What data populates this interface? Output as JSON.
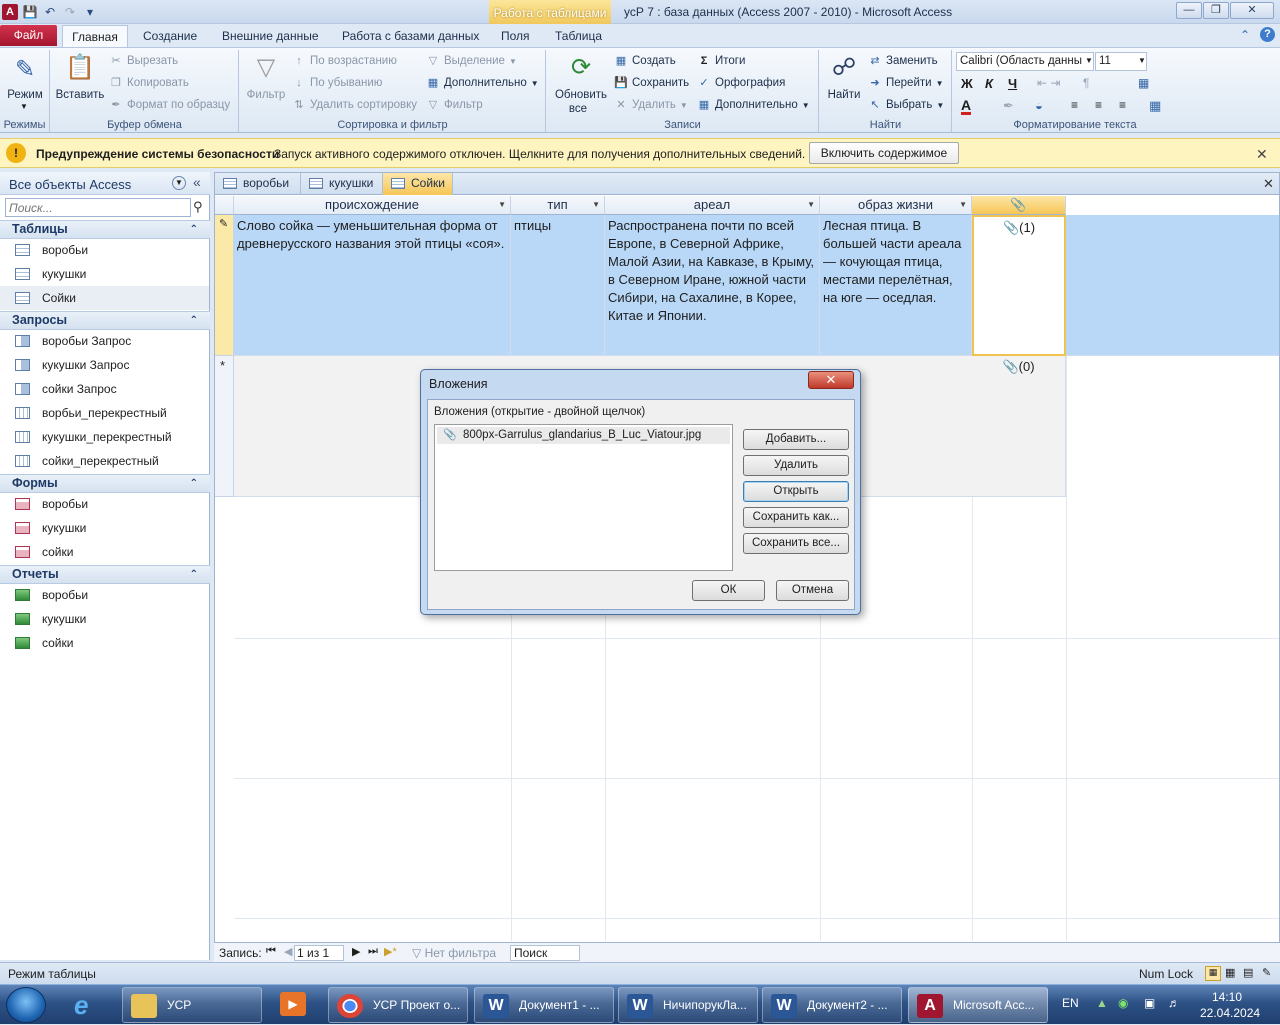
{
  "window": {
    "title": "усР 7 : база данных (Access 2007 - 2010)  -  Microsoft Access",
    "context_tab_group": "Работа с таблицами"
  },
  "ribbon_tabs": [
    "Файл",
    "Главная",
    "Создание",
    "Внешние данные",
    "Работа с базами данных",
    "Поля",
    "Таблица"
  ],
  "ribbon": {
    "modes": {
      "view_label": "Режим",
      "group": "Режимы"
    },
    "clipboard": {
      "paste": "Вставить",
      "cut": "Вырезать",
      "copy": "Копировать",
      "format_painter": "Формат по образцу",
      "group": "Буфер обмена"
    },
    "sort": {
      "filter": "Фильтр",
      "asc": "По возрастанию",
      "desc": "По убыванию",
      "remove": "Удалить сортировку",
      "selection": "Выделение",
      "advanced": "Дополнительно",
      "toggle": "Фильтр",
      "group": "Сортировка и фильтр"
    },
    "records": {
      "refresh": "Обновить",
      "refresh2": "все",
      "new": "Создать",
      "save": "Сохранить",
      "delete": "Удалить",
      "totals": "Итоги",
      "spelling": "Орфография",
      "more": "Дополнительно",
      "group": "Записи"
    },
    "find": {
      "find": "Найти",
      "replace": "Заменить",
      "goto": "Перейти",
      "select": "Выбрать",
      "group": "Найти"
    },
    "text": {
      "font": "Calibri (Область данны",
      "size": "11",
      "group": "Форматирование текста"
    }
  },
  "security": {
    "title": "Предупреждение системы безопасности",
    "message": "Запуск активного содержимого отключен. Щелкните для получения дополнительных сведений.",
    "button": "Включить содержимое"
  },
  "nav": {
    "title": "Все объекты Access",
    "search_placeholder": "Поиск...",
    "sections": [
      {
        "name": "Таблицы",
        "items": [
          "воробьи",
          "кукушки",
          "Сойки"
        ]
      },
      {
        "name": "Запросы",
        "items": [
          "воробьи Запрос",
          "кукушки Запрос",
          "сойки Запрос",
          "ворбьи_перекрестный",
          "кукушки_перекрестный",
          "сойки_перекрестный"
        ]
      },
      {
        "name": "Формы",
        "items": [
          "воробьи",
          "кукушки",
          "сойки"
        ]
      },
      {
        "name": "Отчеты",
        "items": [
          "воробьи",
          "кукушки",
          "сойки"
        ]
      }
    ]
  },
  "doc_tabs": [
    "воробьи",
    "кукушки",
    "Сойки"
  ],
  "grid": {
    "columns": [
      "происхождение",
      "тип",
      "ареал",
      "образ жизни"
    ],
    "rows": [
      {
        "origin": "Слово сойка — уменьшительная форма от древнерусского названия этой птицы «соя».",
        "type": "птицы",
        "range": "Распространена почти по всей Европе, в Северной Африке, Малой Азии, на Кавказе, в Крыму, в Северном Иране, южной части Сибири, на Сахалине, в Корее, Китае и Японии.",
        "life": "Лесная птица. В большей части ареала — кочующая птица, местами перелётная, на юге — оседлая.",
        "attachments": "(1)"
      }
    ],
    "new_row_attachments": "(0)",
    "new_row_marker": "*"
  },
  "record_nav": {
    "label": "Запись:",
    "position": "1 из 1",
    "filter": "Нет фильтра",
    "search": "Поиск"
  },
  "status": {
    "left": "Режим таблицы",
    "numlock": "Num Lock"
  },
  "dialog": {
    "title": "Вложения",
    "list_label": "Вложения (открытие - двойной щелчок)",
    "file": "800px-Garrulus_glandarius_B_Luc_Viatour.jpg",
    "buttons": {
      "add": "Добавить...",
      "remove": "Удалить",
      "open": "Открыть",
      "save_as": "Сохранить как...",
      "save_all": "Сохранить все..."
    },
    "ok": "ОК",
    "cancel": "Отмена"
  },
  "taskbar": {
    "items": [
      "УСР",
      "УСР Проект о...",
      "Документ1 - ...",
      "НичипорукЛа...",
      "Документ2 - ...",
      "Microsoft Acc..."
    ],
    "lang": "EN",
    "time": "14:10",
    "date": "22.04.2024"
  },
  "colors": {
    "accent": "#b9d8f7",
    "file_tab": "#a3152f",
    "security_bar": "#fdf4bf"
  }
}
